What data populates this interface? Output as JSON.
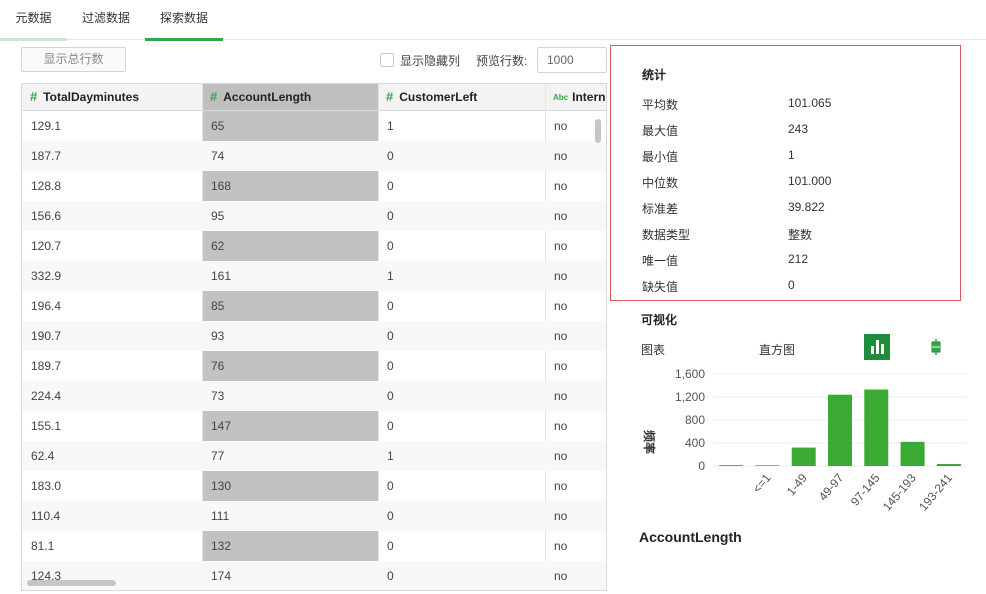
{
  "tabs": [
    {
      "label": "元数据"
    },
    {
      "label": "过滤数据"
    },
    {
      "label": "探索数据"
    }
  ],
  "toolbar": {
    "show_total_label": "显示总行数",
    "show_hidden_label": "显示隐藏列",
    "preview_rows_label": "预览行数:",
    "preview_rows_value": "1000"
  },
  "table": {
    "columns": [
      {
        "name": "TotalDayminutes",
        "type_icon": "hash-icon"
      },
      {
        "name": "AccountLength",
        "type_icon": "hash-icon"
      },
      {
        "name": "CustomerLeft",
        "type_icon": "hash-icon"
      },
      {
        "name": "Interna",
        "type_icon": "abc-icon"
      }
    ],
    "rows": [
      [
        "129.1",
        "65",
        "1",
        "no"
      ],
      [
        "187.7",
        "74",
        "0",
        "no"
      ],
      [
        "128.8",
        "168",
        "0",
        "no"
      ],
      [
        "156.6",
        "95",
        "0",
        "no"
      ],
      [
        "120.7",
        "62",
        "0",
        "no"
      ],
      [
        "332.9",
        "161",
        "1",
        "no"
      ],
      [
        "196.4",
        "85",
        "0",
        "no"
      ],
      [
        "190.7",
        "93",
        "0",
        "no"
      ],
      [
        "189.7",
        "76",
        "0",
        "no"
      ],
      [
        "224.4",
        "73",
        "0",
        "no"
      ],
      [
        "155.1",
        "147",
        "0",
        "no"
      ],
      [
        "62.4",
        "77",
        "1",
        "no"
      ],
      [
        "183.0",
        "130",
        "0",
        "no"
      ],
      [
        "110.4",
        "111",
        "0",
        "no"
      ],
      [
        "81.1",
        "132",
        "0",
        "no"
      ],
      [
        "124.3",
        "174",
        "0",
        "no"
      ]
    ]
  },
  "stats": {
    "title": "统计",
    "rows": [
      {
        "label": "平均数",
        "value": "101.065"
      },
      {
        "label": "最大值",
        "value": "243"
      },
      {
        "label": "最小值",
        "value": "1"
      },
      {
        "label": "中位数",
        "value": "101.000"
      },
      {
        "label": "标准差",
        "value": "39.822"
      },
      {
        "label": "数据类型",
        "value": "整数"
      },
      {
        "label": "唯一值",
        "value": "212"
      },
      {
        "label": "缺失值",
        "value": "0"
      }
    ]
  },
  "viz": {
    "title": "可视化",
    "chart_label": "图表",
    "chart_type_value": "直方图",
    "bar_icon": "bar-chart-icon",
    "box_icon": "boxplot-icon",
    "accent": "#3aaa35"
  },
  "chart_data": {
    "type": "bar",
    "categories": [
      "",
      "<=1",
      "1-49",
      "49-97",
      "97-145",
      "145-193",
      "193-241"
    ],
    "values": [
      15,
      12,
      320,
      1240,
      1330,
      420,
      35
    ],
    "ylim": [
      0,
      1600
    ],
    "yticks": [
      "0",
      "400",
      "800",
      "1,200",
      "1,600"
    ],
    "ylabel": "频率",
    "xlabel": "AccountLength",
    "grid": true
  }
}
